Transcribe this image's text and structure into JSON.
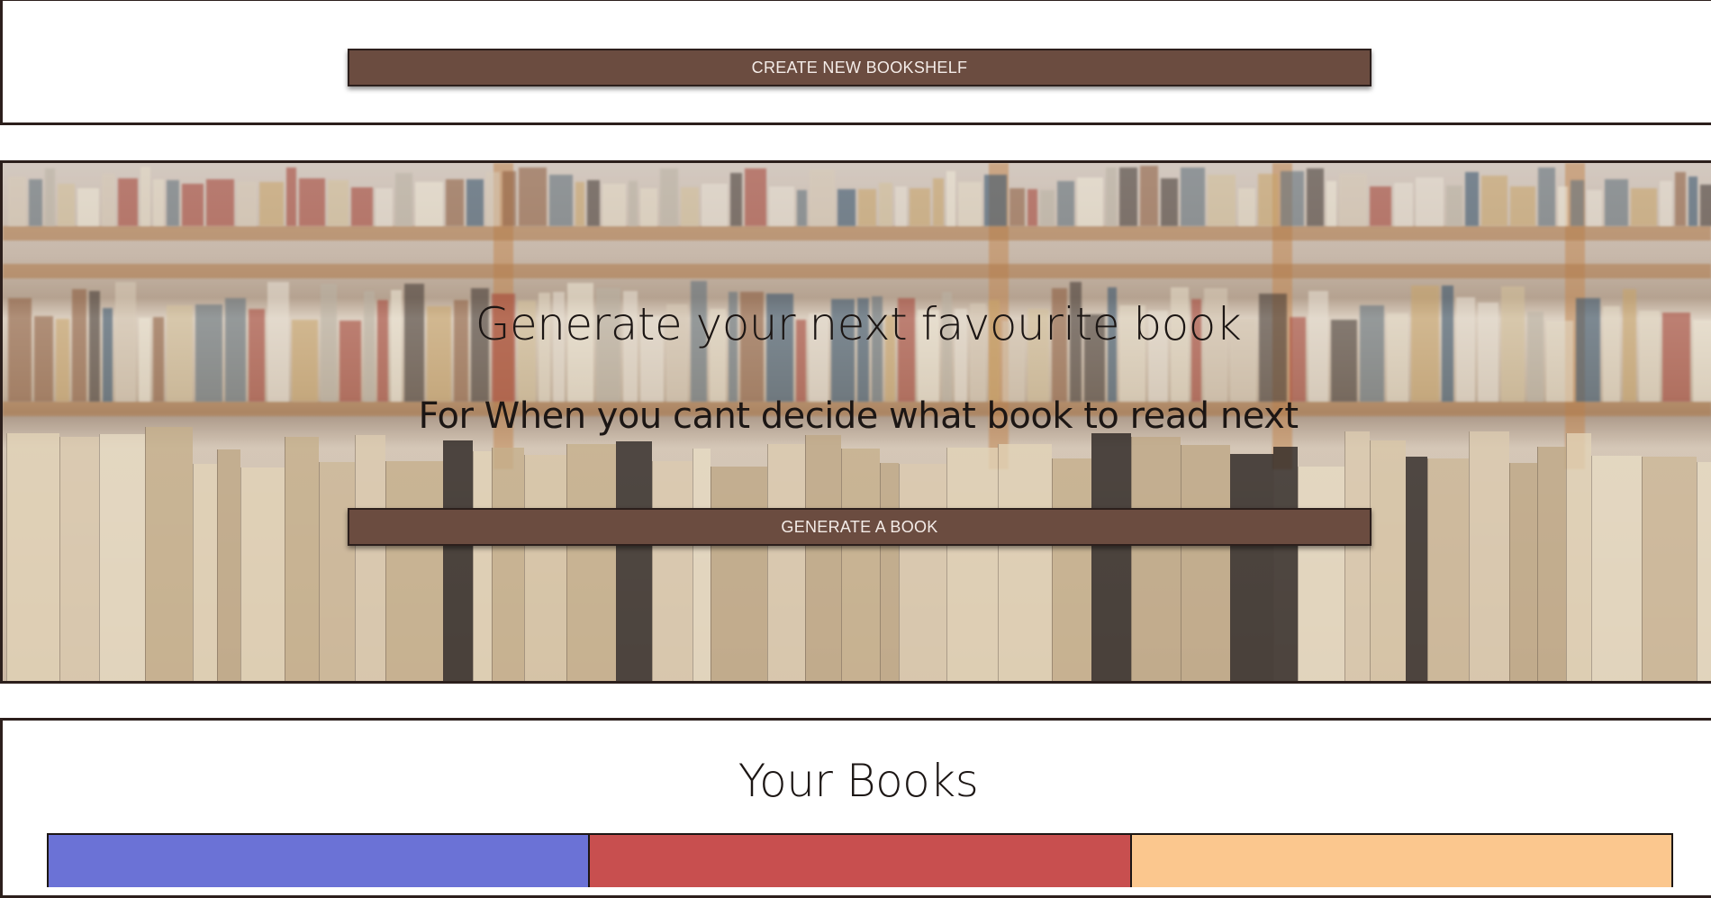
{
  "top_panel": {
    "create_bookshelf_label": "CREATE NEW BOOKSHELF"
  },
  "hero": {
    "title": "Generate your next favourite book",
    "subtitle": "For When you cant decide what book to read next",
    "generate_label": "GENERATE A BOOK"
  },
  "books_section": {
    "title": "Your Books",
    "cards": [
      {
        "color": "#6b72d6"
      },
      {
        "color": "#c84f4f"
      },
      {
        "color": "#fbc78e"
      }
    ]
  },
  "colors": {
    "button_bg": "#6b4c40",
    "border": "#2c1f1c"
  }
}
